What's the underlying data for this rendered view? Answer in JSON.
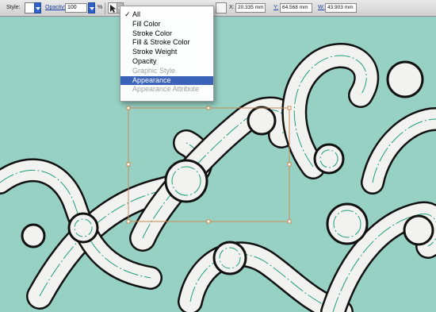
{
  "toolbar": {
    "style_label": "Style:",
    "opacity_label": "Opacity:",
    "opacity_value": "100",
    "opacity_unit": "%",
    "x_label": "X:",
    "x_value": "20.335 mm",
    "y_label": "Y:",
    "y_value": "64.568 mm",
    "w_label": "W:",
    "w_value": "43.903 mm"
  },
  "menu": {
    "items": [
      {
        "label": "All",
        "checked": true,
        "disabled": false,
        "selected": false
      },
      {
        "label": "Fill Color",
        "checked": false,
        "disabled": false,
        "selected": false
      },
      {
        "label": "Stroke Color",
        "checked": false,
        "disabled": false,
        "selected": false
      },
      {
        "label": "Fill & Stroke Color",
        "checked": false,
        "disabled": false,
        "selected": false
      },
      {
        "label": "Stroke Weight",
        "checked": false,
        "disabled": false,
        "selected": false
      },
      {
        "label": "Opacity",
        "checked": false,
        "disabled": false,
        "selected": false
      },
      {
        "label": "Graphic Style",
        "checked": false,
        "disabled": true,
        "selected": false
      },
      {
        "label": "Appearance",
        "checked": false,
        "disabled": false,
        "selected": true
      },
      {
        "label": "Appearance Attribute",
        "checked": false,
        "disabled": true,
        "selected": false
      }
    ]
  },
  "colors": {
    "background": "#96d1c4",
    "swirl_fill": "#f2f3f1",
    "swirl_outline": "#111111",
    "accent_line": "#1e9e7a",
    "selection": "#c98a55",
    "menu_highlight": "#3b63b9"
  }
}
